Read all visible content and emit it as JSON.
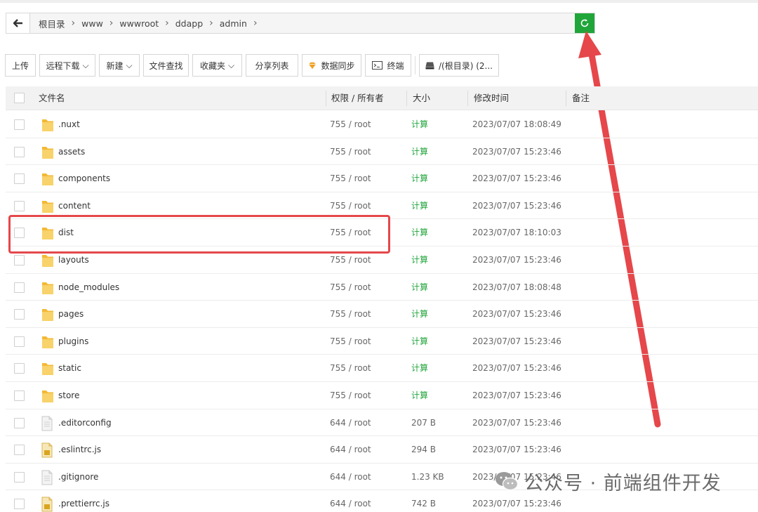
{
  "breadcrumb": {
    "items": [
      "根目录",
      "www",
      "wwwroot",
      "ddapp",
      "admin"
    ]
  },
  "toolbar": {
    "upload": "上传",
    "remote_download": "远程下载",
    "new": "新建",
    "file_search": "文件查找",
    "favorites": "收藏夹",
    "share_list": "分享列表",
    "data_sync": "数据同步",
    "terminal": "终端",
    "disk": "/(根目录) (2..."
  },
  "table": {
    "headers": {
      "name": "文件名",
      "perm": "权限 / 所有者",
      "size": "大小",
      "mtime": "修改时间",
      "note": "备注"
    },
    "rows": [
      {
        "name": ".nuxt",
        "type": "folder",
        "perm": "755 / root",
        "size": "计算",
        "mtime": "2023/07/07 18:08:49"
      },
      {
        "name": "assets",
        "type": "folder",
        "perm": "755 / root",
        "size": "计算",
        "mtime": "2023/07/07 15:23:46"
      },
      {
        "name": "components",
        "type": "folder",
        "perm": "755 / root",
        "size": "计算",
        "mtime": "2023/07/07 15:23:46"
      },
      {
        "name": "content",
        "type": "folder",
        "perm": "755 / root",
        "size": "计算",
        "mtime": "2023/07/07 15:23:46"
      },
      {
        "name": "dist",
        "type": "folder",
        "perm": "755 / root",
        "size": "计算",
        "mtime": "2023/07/07 18:10:03"
      },
      {
        "name": "layouts",
        "type": "folder",
        "perm": "755 / root",
        "size": "计算",
        "mtime": "2023/07/07 15:23:46"
      },
      {
        "name": "node_modules",
        "type": "folder",
        "perm": "755 / root",
        "size": "计算",
        "mtime": "2023/07/07 18:08:48"
      },
      {
        "name": "pages",
        "type": "folder",
        "perm": "755 / root",
        "size": "计算",
        "mtime": "2023/07/07 15:23:46"
      },
      {
        "name": "plugins",
        "type": "folder",
        "perm": "755 / root",
        "size": "计算",
        "mtime": "2023/07/07 15:23:46"
      },
      {
        "name": "static",
        "type": "folder",
        "perm": "755 / root",
        "size": "计算",
        "mtime": "2023/07/07 15:23:46"
      },
      {
        "name": "store",
        "type": "folder",
        "perm": "755 / root",
        "size": "计算",
        "mtime": "2023/07/07 15:23:46"
      },
      {
        "name": ".editorconfig",
        "type": "file",
        "perm": "644 / root",
        "size": "207 B",
        "mtime": "2023/07/07 15:23:46"
      },
      {
        "name": ".eslintrc.js",
        "type": "js",
        "perm": "644 / root",
        "size": "294 B",
        "mtime": "2023/07/07 15:23:46"
      },
      {
        "name": ".gitignore",
        "type": "file",
        "perm": "644 / root",
        "size": "1.23 KB",
        "mtime": "2023/07/07 15:23:46"
      },
      {
        "name": ".prettierrc.js",
        "type": "js",
        "perm": "644 / root",
        "size": "742 B",
        "mtime": "2023/07/07 15:23:46"
      }
    ]
  },
  "watermark": "公众号 · 前端组件开发",
  "colors": {
    "accent_green": "#20a53a",
    "annotation_red": "#e5474b",
    "folder_yellow": "#f7c948"
  }
}
